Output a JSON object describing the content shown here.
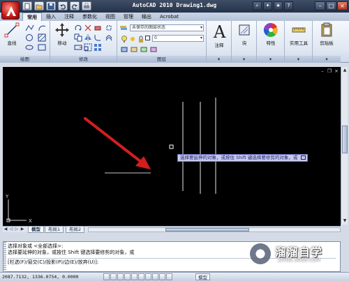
{
  "app": {
    "window_title": "AutoCAD 2010  Drawing1.dwg",
    "logo_icon": "autocad-a-logo-icon"
  },
  "quick_access": [
    "new-file-icon",
    "open-file-icon",
    "save-icon",
    "undo-icon",
    "redo-icon",
    "print-icon"
  ],
  "ribbon_tabs": [
    {
      "label": "常用",
      "active": true
    },
    {
      "label": "插入"
    },
    {
      "label": "注释"
    },
    {
      "label": "参数化"
    },
    {
      "label": "视图"
    },
    {
      "label": "管理"
    },
    {
      "label": "输出"
    },
    {
      "label": "Acrobat"
    }
  ],
  "ribbon": {
    "draw": {
      "label": "绘图",
      "line_label": "直线"
    },
    "modify": {
      "label": "修改",
      "move_label": "移动"
    },
    "layers": {
      "label": "图层",
      "layer_state": "未保存的图层状态",
      "current_layer": "0"
    },
    "annotation": {
      "label": "注释"
    },
    "block": {
      "label": "块"
    },
    "properties": {
      "label": "特性"
    },
    "utilities": {
      "label": "实用工具"
    },
    "clipboard": {
      "label": "剪贴板"
    }
  },
  "canvas": {
    "background": "#000000",
    "tooltip": "选择要延伸的对象，或按住 Shift 键选择要修剪的对象，或",
    "arrow_color": "#d41e1e",
    "ucs_x": "X",
    "ucs_y": "Y"
  },
  "layout_tabs": [
    "模型",
    "布局1",
    "布局2"
  ],
  "command_line": {
    "line1": "选择对象或 <全部选择>:",
    "line2": "选择要延伸的对象，或按住 Shift 键选择要修剪的对象，或",
    "line3": "[栏选(F)/窗交(C)/投影(P)/边(E)/放弃(U)]:"
  },
  "status": {
    "coords": "2087.7132, 1336.0754, 0.0000",
    "model_label": "模型"
  },
  "watermark": {
    "title": "溜溜自学",
    "url": "ZIXUE.3D66.COM"
  }
}
